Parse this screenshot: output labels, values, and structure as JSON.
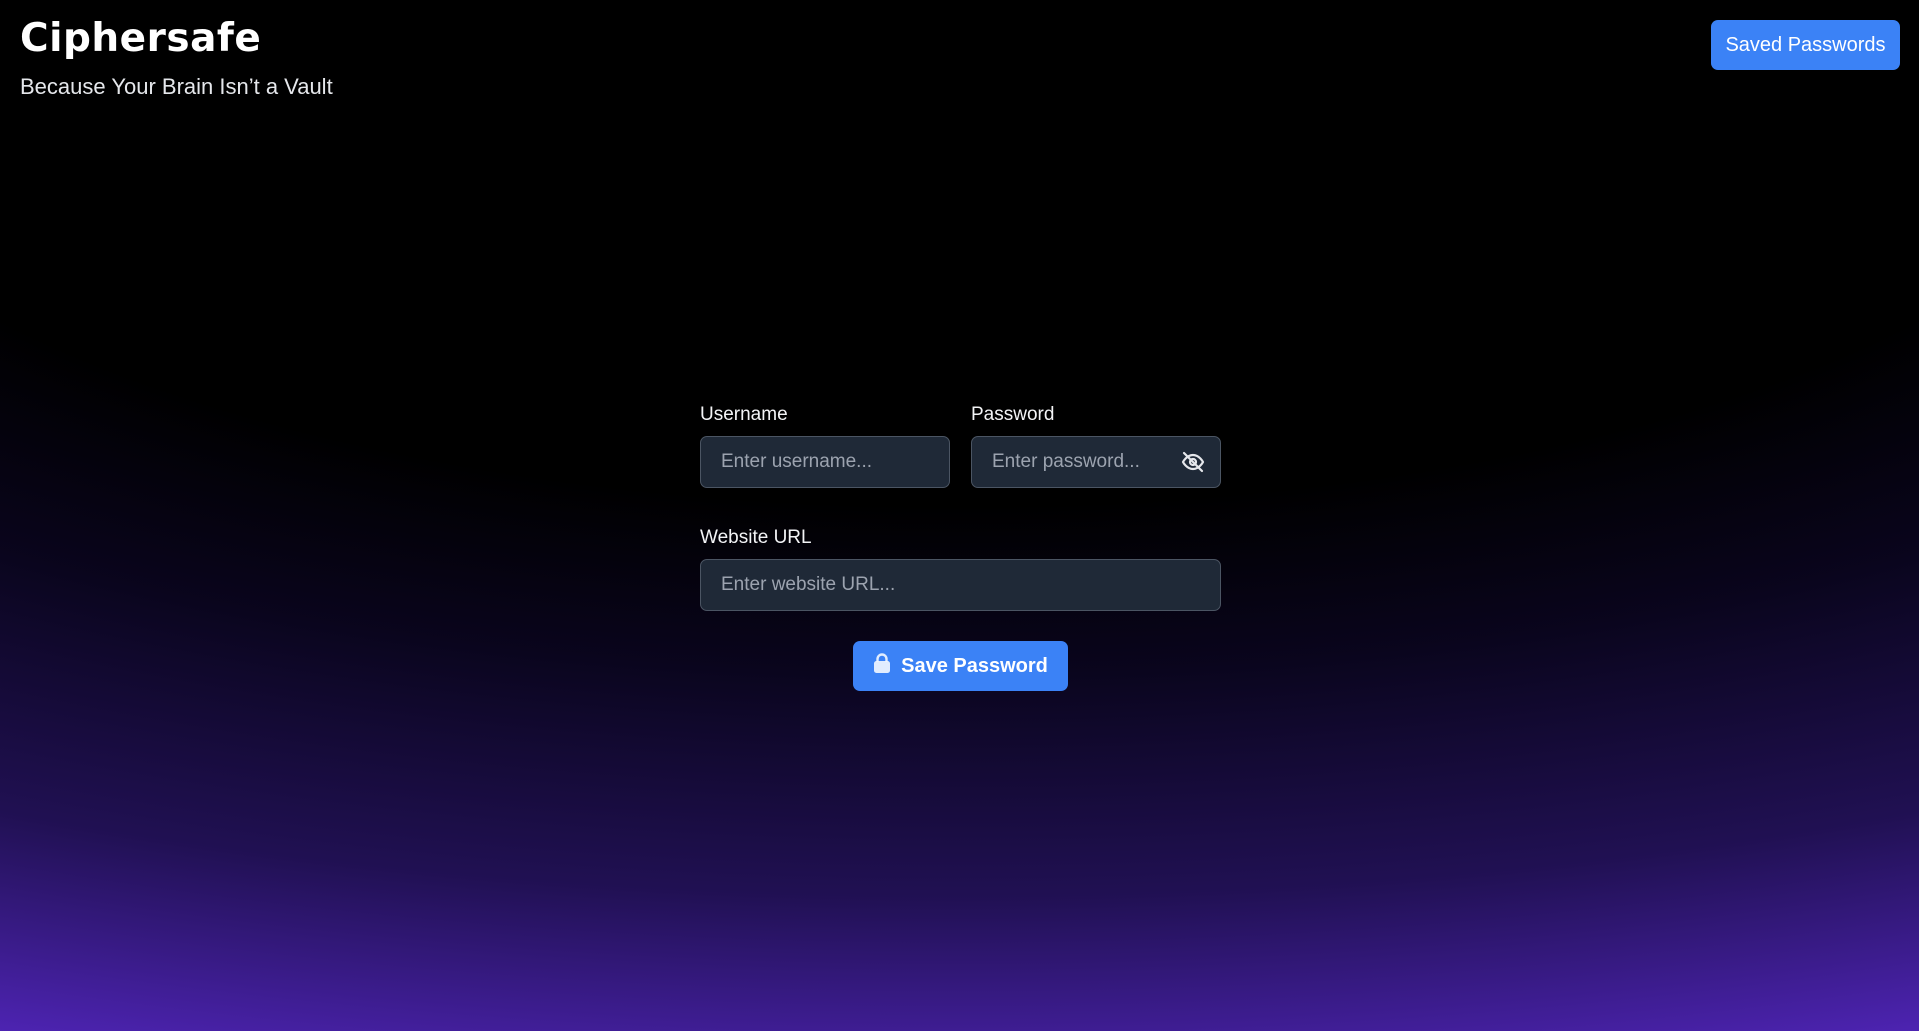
{
  "header": {
    "title": "Ciphersafe",
    "tagline": "Because Your Brain Isn’t a Vault",
    "saved_passwords_label": "Saved Passwords"
  },
  "form": {
    "username": {
      "label": "Username",
      "placeholder": "Enter username...",
      "value": ""
    },
    "password": {
      "label": "Password",
      "placeholder": "Enter password...",
      "value": "",
      "toggle_icon": "eye-off-icon"
    },
    "website": {
      "label": "Website URL",
      "placeholder": "Enter website URL...",
      "value": ""
    },
    "save_label": "Save Password",
    "save_icon": "lock-icon"
  },
  "colors": {
    "accent": "#3b82f6",
    "input_bg": "#1f2937",
    "input_border": "#4b5563",
    "gradient_bottom": "#4e24b4"
  }
}
